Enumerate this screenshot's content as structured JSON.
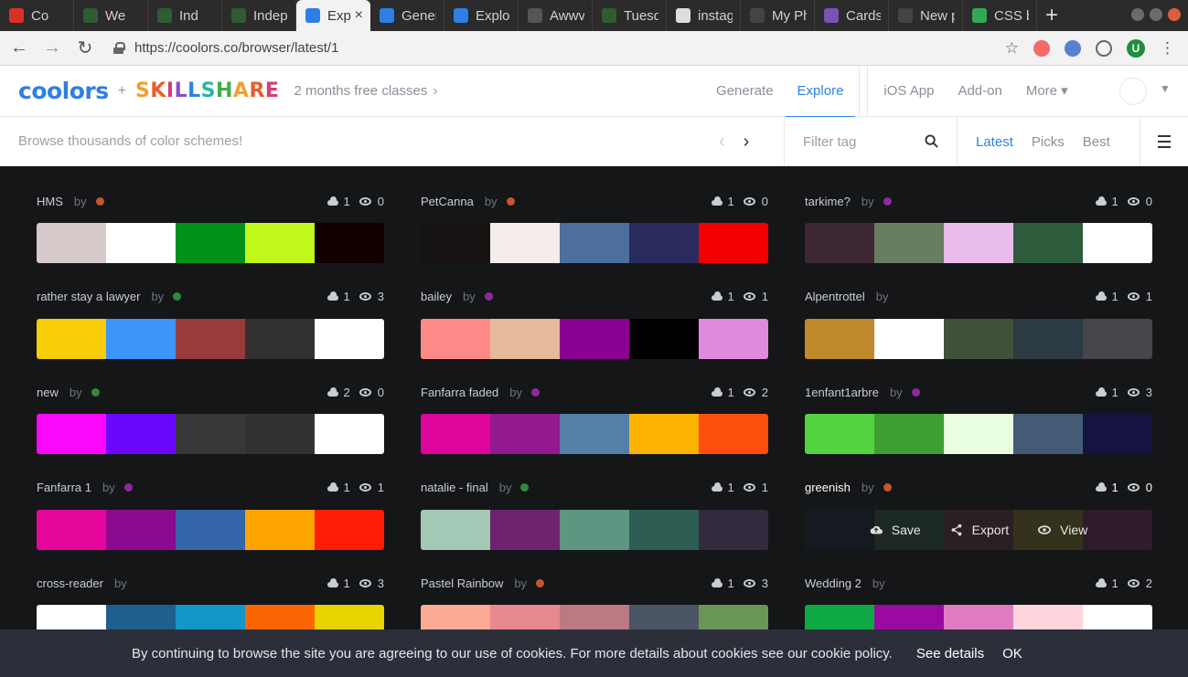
{
  "browser": {
    "tabs": [
      {
        "title": "Co",
        "favicon_color": "#d93025"
      },
      {
        "title": "We",
        "favicon_color": "#2f5d2f"
      },
      {
        "title": "Ind",
        "favicon_color": "#2f5d2f"
      },
      {
        "title": "Indep",
        "favicon_color": "#2f5d2f"
      },
      {
        "title": "Exp",
        "favicon_color": "#2d7fe6",
        "active": true
      },
      {
        "title": "Gener",
        "favicon_color": "#2d7fe6"
      },
      {
        "title": "Explo",
        "favicon_color": "#2d7fe6"
      },
      {
        "title": "Awwv",
        "favicon_color": "#555555",
        "prefix": "W."
      },
      {
        "title": "Tuesd",
        "favicon_color": "#2f5d2f"
      },
      {
        "title": "instag",
        "favicon_color": "#dddddd"
      },
      {
        "title": "My Ph",
        "favicon_color": "#444444"
      },
      {
        "title": "Cards",
        "favicon_color": "#7952b3",
        "prefix": "B"
      },
      {
        "title": "New p",
        "favicon_color": "#444444"
      },
      {
        "title": "CSS ba",
        "favicon_color": "#34a853"
      }
    ],
    "new_tab": "+",
    "url": "https://coolors.co/browser/latest/1",
    "avatar_letter": "U"
  },
  "header": {
    "logo": "coolors",
    "plus": "+",
    "partner": "SKILLSHARE",
    "promo": "2 months free classes",
    "nav": [
      "Generate",
      "Explore",
      "iOS App",
      "Add-on",
      "More"
    ],
    "active_nav": "Explore"
  },
  "subbar": {
    "browse_text": "Browse thousands of color schemes!",
    "filter_placeholder": "Filter tag",
    "sorts": [
      "Latest",
      "Picks",
      "Best"
    ],
    "active_sort": "Latest"
  },
  "palettes": [
    {
      "name": "HMS",
      "by": "by",
      "dot": "#c0582a",
      "saves": "1",
      "views": "0",
      "colors": [
        "#d5c9c9",
        "#ffffff",
        "#00911b",
        "#c1f71c",
        "#120000"
      ]
    },
    {
      "name": "PetCanna",
      "by": "by",
      "dot": "#c0582a",
      "saves": "1",
      "views": "0",
      "colors": [
        "#161212",
        "#f6ecec",
        "#4c6f9d",
        "#2b2c5e",
        "#f20000"
      ]
    },
    {
      "name": "tarkime?",
      "by": "by",
      "dot": "#8e2a9b",
      "saves": "1",
      "views": "0",
      "colors": [
        "#3f2836",
        "#687e60",
        "#e9bcec",
        "#2f5c3c",
        "#ffffff"
      ]
    },
    {
      "name": "rather stay a lawyer",
      "by": "by",
      "dot": "#2e8b3d",
      "saves": "1",
      "views": "3",
      "colors": [
        "#f8cc07",
        "#3d95fc",
        "#993b3c",
        "#313132",
        "#ffffff"
      ]
    },
    {
      "name": "bailey",
      "by": "by",
      "dot": "#8e2a9b",
      "saves": "1",
      "views": "1",
      "colors": [
        "#fd8a87",
        "#e5b99a",
        "#8a0090",
        "#000000",
        "#df8ade"
      ]
    },
    {
      "name": "Alpentrottel",
      "by": "by",
      "dot": "",
      "saves": "1",
      "views": "1",
      "colors": [
        "#bf8a2c",
        "#ffffff",
        "#415039",
        "#2c3a44",
        "#48454a"
      ]
    },
    {
      "name": "new",
      "by": "by",
      "dot": "#2e8b3d",
      "saves": "2",
      "views": "0",
      "colors": [
        "#fb08fb",
        "#6a07fc",
        "#383838",
        "#323232",
        "#ffffff"
      ]
    },
    {
      "name": "Fanfarra faded",
      "by": "by",
      "dot": "#8e2a9b",
      "saves": "1",
      "views": "2",
      "colors": [
        "#df049c",
        "#92198f",
        "#547fa8",
        "#fcb401",
        "#fe4e0d"
      ]
    },
    {
      "name": "1enfant1arbre",
      "by": "by",
      "dot": "#8e2a9b",
      "saves": "1",
      "views": "3",
      "colors": [
        "#53d33f",
        "#3da132",
        "#e9fde1",
        "#455a74",
        "#151440"
      ]
    },
    {
      "name": "Fanfarra 1",
      "by": "by",
      "dot": "#8e2a9b",
      "saves": "1",
      "views": "1",
      "colors": [
        "#e5079c",
        "#8c0a8f",
        "#3465a9",
        "#fea400",
        "#fe1d04"
      ]
    },
    {
      "name": "natalie - final",
      "by": "by",
      "dot": "#2e8b3d",
      "saves": "1",
      "views": "1",
      "colors": [
        "#a2c9b6",
        "#6e236f",
        "#5f9681",
        "#2d5d53",
        "#312b3d"
      ]
    },
    {
      "name": "greenish",
      "by": "by",
      "dot": "#c0582a",
      "saves": "1",
      "views": "0",
      "colors": [
        "#141a1f",
        "#1c2925",
        "#2a1f22",
        "#34321c",
        "#2e1c2a"
      ],
      "hover": true
    },
    {
      "name": "cross-reader",
      "by": "by",
      "dot": "",
      "saves": "1",
      "views": "3",
      "colors": [
        "#ffffff",
        "#1e5f8e",
        "#1496c8",
        "#fb6603",
        "#e8d400"
      ]
    },
    {
      "name": "Pastel Rainbow",
      "by": "by",
      "dot": "#c0582a",
      "saves": "1",
      "views": "3",
      "colors": [
        "#fdaa95",
        "#e9888e",
        "#b97a84",
        "#4a5566",
        "#6a9656"
      ]
    },
    {
      "name": "Wedding 2",
      "by": "by",
      "dot": "",
      "saves": "1",
      "views": "2",
      "colors": [
        "#0ea844",
        "#9a0aa0",
        "#df7cc1",
        "#fed5dc",
        "#ffffff"
      ]
    }
  ],
  "hover_actions": [
    "Save",
    "Export",
    "View"
  ],
  "cookie": {
    "message": "By continuing to browse the site you are agreeing to our use of cookies. For more details about cookies see our cookie policy.",
    "details": "See details",
    "ok": "OK"
  }
}
